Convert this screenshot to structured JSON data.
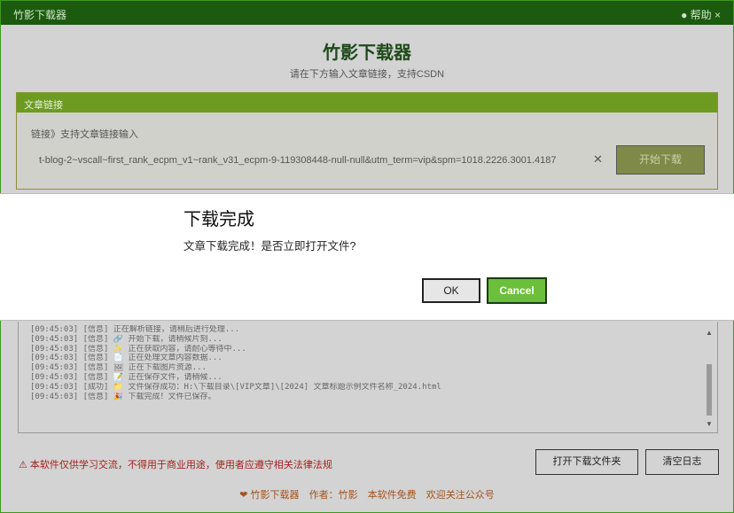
{
  "window": {
    "title": "竹影下载器",
    "controls": "● 帮助 ×"
  },
  "header": {
    "title": "竹影下载器",
    "subtitle": "请在下方输入文章链接，支持CSDN"
  },
  "panel": {
    "heading": "文章链接",
    "label": "链接》支持文章链接输入",
    "url": "t-blog-2~vscall~first_rank_ecpm_v1~rank_v31_ecpm-9-119308448-null-null&utm_term=vip&spm=1018.2226.3001.4187",
    "clear_glyph": "✕",
    "download_label": "开始下载"
  },
  "dialog": {
    "title": "下载完成",
    "message": "文章下载完成！是否立即打开文件?",
    "ok_label": "OK",
    "cancel_label": "Cancel"
  },
  "log": {
    "lines": [
      "[09:45:03] [信息] 正在解析链接，请稍后进行处理...",
      "[09:45:03] [信息] 🔗 开始下载，请稍候片刻...",
      "[09:45:03] [信息] ✨ 正在获取内容，请耐心等待中...",
      "[09:45:03] [信息] 📄 正在处理文章内容数据...",
      "[09:45:03] [信息] 🖼 正在下载图片资源...",
      "[09:45:03] [信息] 📝 正在保存文件，请稍候...",
      "[09:45:03] [成功] 📁 文件保存成功：H:\\下载目录\\[VIP文章]\\[2024] 文章标题示例文件名称_2024.html",
      "[09:45:03] [信息] 🎉 下载完成！文件已保存。"
    ],
    "scroll_up": "▲",
    "scroll_down": "▼"
  },
  "actions": {
    "open_folder_label": "打开下载文件夹",
    "clear_log_label": "清空日志"
  },
  "warning": "⚠ 本软件仅供学习交流，不得用于商业用途，使用者应遵守相关法律法规",
  "footer": {
    "items": [
      "❤ 竹影下载器",
      "作者：竹影",
      "本软件免费",
      "欢迎关注公众号"
    ]
  },
  "colors": {
    "titlebar": "#1c5a10",
    "accent_green": "#6cbf3a",
    "panel_header": "#6d9b22",
    "warning_red": "#a3231d"
  }
}
